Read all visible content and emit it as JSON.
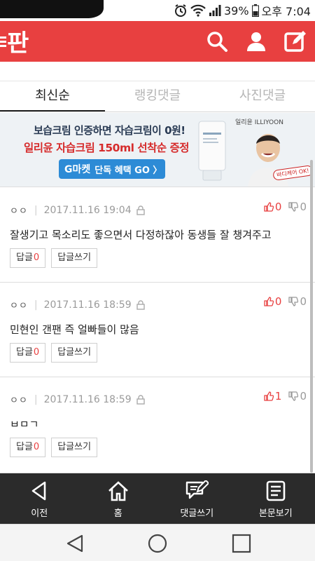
{
  "status_bar": {
    "battery": "39%",
    "time": "오후 7:04"
  },
  "app": {
    "logo_text": "판"
  },
  "tabs": [
    {
      "label": "최신순",
      "active": true
    },
    {
      "label": "랭킹댓글",
      "active": false
    },
    {
      "label": "사진댓글",
      "active": false
    }
  ],
  "banner": {
    "line1": "보습크림 인증하면 자습크림이 0원!",
    "line2": "일리윤 자습크림 150ml 선착순 증정",
    "button_prefix": "G마켓",
    "button_label": "단독 혜택 GO 〉",
    "brand": "일리윤 ILLIYOON",
    "badge": "바디케어 OK!"
  },
  "comments": [
    {
      "author": "ㅇㅇ",
      "date": "2017.11.16 19:04",
      "up": "0",
      "down": "0",
      "text": "잘생기고 목소리도 좋으면서 다정하잖아 동생들 잘 챙겨주고",
      "reply_label": "답글",
      "reply_count": "0",
      "write_label": "답글쓰기"
    },
    {
      "author": "ㅇㅇ",
      "date": "2017.11.16 18:59",
      "up": "0",
      "down": "0",
      "text": "민현인 갠팬 즉 얼빠들이 많음",
      "reply_label": "답글",
      "reply_count": "0",
      "write_label": "답글쓰기"
    },
    {
      "author": "ㅇㅇ",
      "date": "2017.11.16 18:59",
      "up": "1",
      "down": "0",
      "text": "ㅂㅁㄱ",
      "reply_label": "답글",
      "reply_count": "0",
      "write_label": "답글쓰기"
    }
  ],
  "bottom_nav": {
    "prev": "이전",
    "home": "홈",
    "write_comment": "댓글쓰기",
    "view_article": "본문보기"
  },
  "colors": {
    "brand_red": "#e84040",
    "nav_dark": "#2b2b2b"
  }
}
